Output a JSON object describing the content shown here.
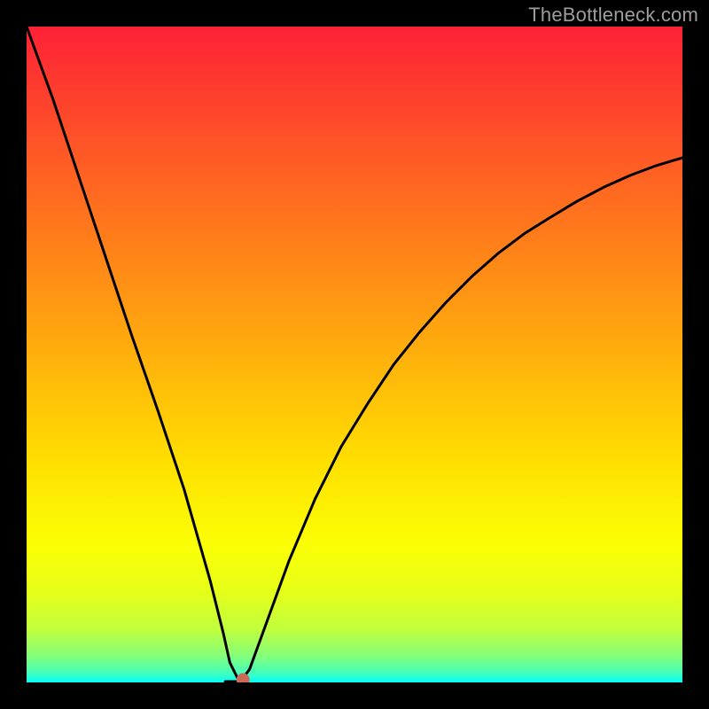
{
  "watermark": "TheBottleneck.com",
  "chart_data": {
    "type": "line",
    "title": "",
    "xlabel": "",
    "ylabel": "",
    "xlim": [
      0,
      100
    ],
    "ylim": [
      0,
      100
    ],
    "gradient_meaning": "vertical rainbow background: red (top) = high bottleneck, green/cyan (bottom) = zero bottleneck",
    "min_point": {
      "x": 32.5,
      "y": 0
    },
    "series": [
      {
        "name": "bottleneck-curve",
        "x": [
          0,
          4,
          8,
          12,
          16,
          20,
          24,
          28,
          30,
          31,
          32.5,
          34,
          36,
          40,
          44,
          48,
          52,
          56,
          60,
          64,
          68,
          72,
          76,
          80,
          84,
          88,
          92,
          96,
          100
        ],
        "values": [
          100,
          89,
          77,
          65,
          53,
          41.5,
          29.5,
          15.5,
          7.5,
          3,
          0,
          2,
          7.5,
          18.5,
          28,
          36,
          42.5,
          48.5,
          53.5,
          58,
          62,
          65.5,
          68.5,
          71,
          73.4,
          75.5,
          77.3,
          78.8,
          80
        ]
      }
    ]
  }
}
